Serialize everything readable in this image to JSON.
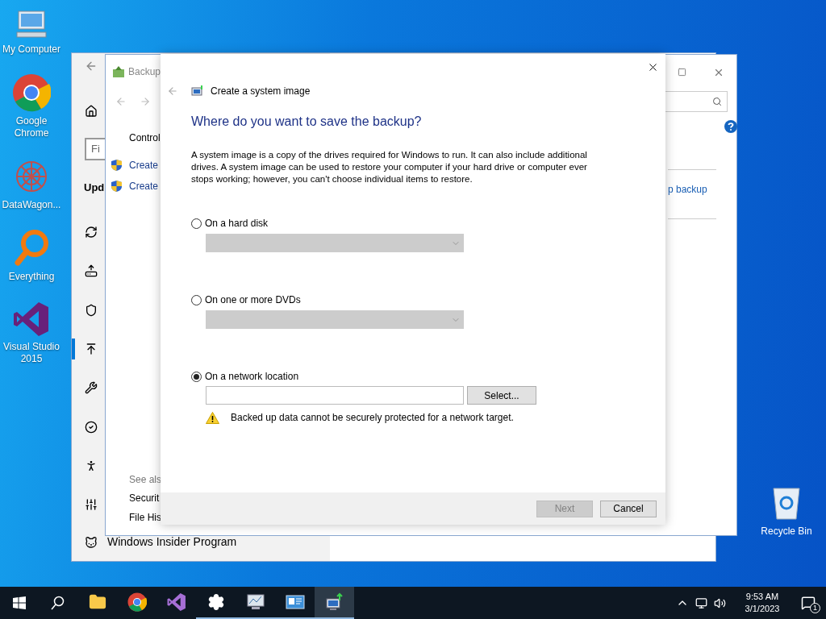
{
  "desktop_icons": [
    {
      "label": "My Computer"
    },
    {
      "label": "Google Chrome"
    },
    {
      "label": "DataWagon..."
    },
    {
      "label": "Everything"
    },
    {
      "label": "Visual Studio 2015"
    }
  ],
  "recycle_bin": {
    "label": "Recycle Bin"
  },
  "settings_window": {
    "search": {
      "placeholder": "Fi"
    },
    "heading": "Upd",
    "nav_items": [
      {
        "selected": false
      },
      {
        "selected": false
      },
      {
        "selected": false
      },
      {
        "selected": true
      },
      {
        "selected": false
      },
      {
        "selected": false
      },
      {
        "selected": false
      },
      {
        "selected": false
      }
    ],
    "footer_item": "Windows Insider Program"
  },
  "control_panel_window": {
    "title": "Backup",
    "breadcrumb": "Control",
    "tasks": [
      "Create",
      "Create"
    ],
    "see_also_heading": "See als",
    "see_also": [
      "Securit",
      "File His"
    ],
    "link": "p backup"
  },
  "dialog": {
    "title": "Create a system image",
    "heading": "Where do you want to save the backup?",
    "description": "A system image is a copy of the drives required for Windows to run. It can also include additional drives. A system image can be used to restore your computer if your hard drive or computer ever stops working; however, you can't choose individual items to restore.",
    "options": [
      {
        "label": "On a hard disk",
        "selected": false,
        "kind": "dropdown"
      },
      {
        "label": "On one or more DVDs",
        "selected": false,
        "kind": "dropdown"
      },
      {
        "label": "On a network location",
        "selected": true,
        "kind": "path",
        "button": "Select..."
      }
    ],
    "warning": "Backed up data cannot be securely protected for a network target.",
    "buttons": [
      {
        "label": "Next",
        "disabled": true
      },
      {
        "label": "Cancel",
        "disabled": false
      }
    ]
  },
  "taskbar": {
    "apps": [
      {
        "running": false,
        "selected": false
      },
      {
        "running": false,
        "selected": false
      },
      {
        "running": false,
        "selected": false
      },
      {
        "running": true,
        "selected": false
      },
      {
        "running": true,
        "selected": false
      },
      {
        "running": true,
        "selected": false
      },
      {
        "running": true,
        "selected": true
      }
    ],
    "time": "9:53 AM",
    "date": "3/1/2023",
    "notification_count": "1"
  }
}
